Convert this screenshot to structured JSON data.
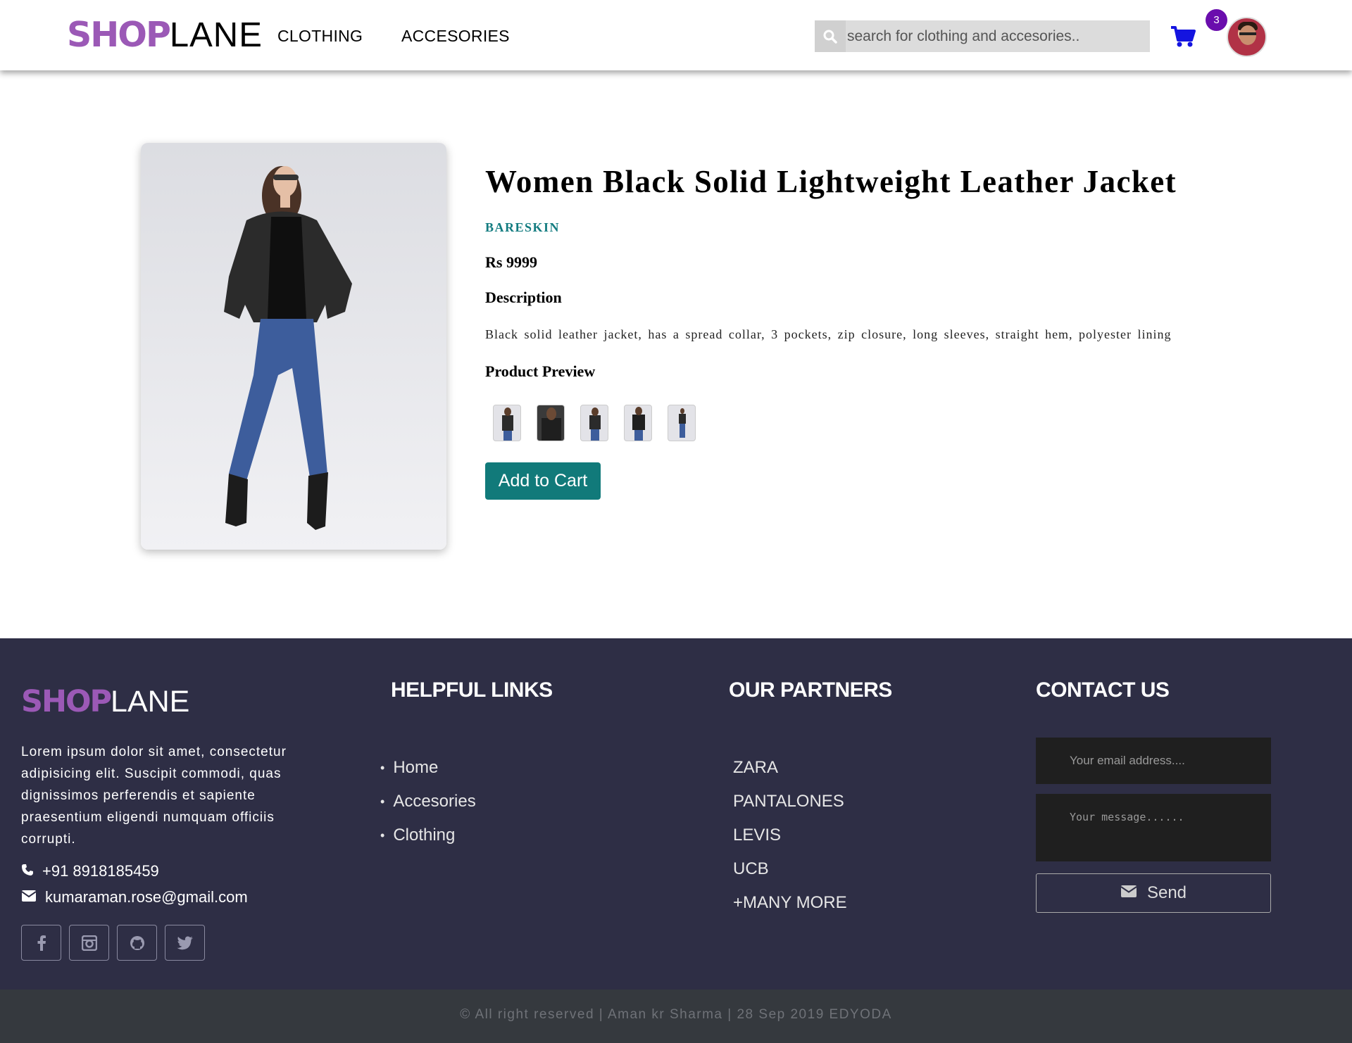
{
  "header": {
    "logo_shop": "SHOP",
    "logo_lane": "LANE",
    "nav": [
      "CLOTHING",
      "ACCESORIES"
    ],
    "search_placeholder": "search for clothing and accesories..",
    "cart_count": "3",
    "accent": "#9b59b6",
    "badge_color": "#6a0dad",
    "cart_icon_color": "#1414e0"
  },
  "product": {
    "title": "Women Black Solid Lightweight Leather Jacket",
    "brand": "BARESKIN",
    "price": "Rs 9999",
    "description_heading": "Description",
    "description": "Black solid leather jacket, has a spread collar, 3 pockets, zip closure, long sleeves, straight hem, polyester lining",
    "preview_heading": "Product Preview",
    "preview_count": 5,
    "add_to_cart": "Add to Cart",
    "brand_color": "#137c80",
    "button_color": "#117a7a"
  },
  "footer": {
    "logo_shop": "SHOP",
    "logo_lane": "LANE",
    "about": "Lorem ipsum dolor sit amet, consectetur adipisicing elit. Suscipit commodi, quas dignissimos perferendis et sapiente praesentium eligendi numquam officiis corrupti.",
    "phone": "+91 8918185459",
    "email": "kumaraman.rose@gmail.com",
    "socials": [
      "facebook-icon",
      "instagram-icon",
      "github-icon",
      "twitter-icon"
    ],
    "helpful_links_heading": "HELPFUL LINKS",
    "helpful_links": [
      "Home",
      "Accesories",
      "Clothing"
    ],
    "partners_heading": "OUR PARTNERS",
    "partners": [
      "ZARA",
      "PANTALONES",
      "LEVIS",
      "UCB",
      "+MANY MORE"
    ],
    "contact_heading": "CONTACT US",
    "email_placeholder": "Your email address....",
    "message_placeholder": "Your message......",
    "send_label": "Send",
    "background": "#2e2e45"
  },
  "copyright": "© All right reserved | Aman kr Sharma | 28 Sep 2019 EDYODA"
}
